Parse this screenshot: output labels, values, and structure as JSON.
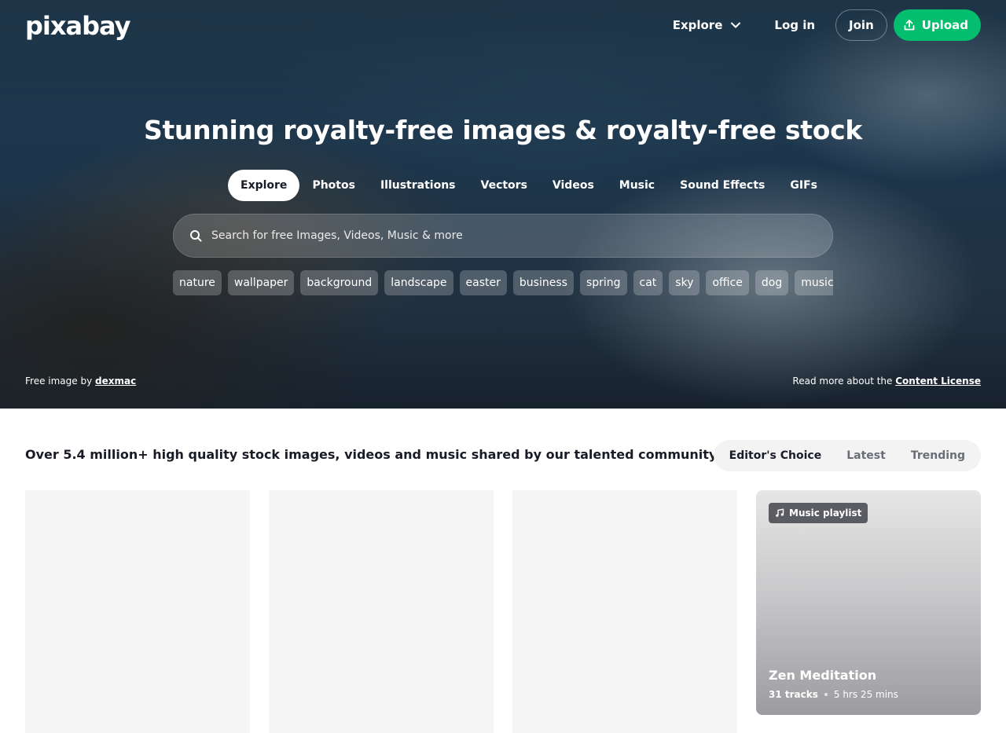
{
  "brand": {
    "logo_text": "pixabay",
    "accent_color": "#02be6e"
  },
  "topnav": {
    "explore_label": "Explore",
    "login_label": "Log in",
    "join_label": "Join",
    "upload_label": "Upload"
  },
  "hero": {
    "title": "Stunning royalty-free images & royalty-free stock",
    "tabs": [
      {
        "label": "Explore",
        "active": true
      },
      {
        "label": "Photos"
      },
      {
        "label": "Illustrations"
      },
      {
        "label": "Vectors"
      },
      {
        "label": "Videos"
      },
      {
        "label": "Music"
      },
      {
        "label": "Sound Effects"
      },
      {
        "label": "GIFs"
      }
    ],
    "search_placeholder": "Search for free Images, Videos, Music & more",
    "chips": [
      "nature",
      "wallpaper",
      "background",
      "landscape",
      "easter",
      "business",
      "spring",
      "cat",
      "sky",
      "office",
      "dog",
      "music"
    ],
    "credit_prefix": "Free image by",
    "credit_author": "dexmac",
    "license_prefix": "Read more about the",
    "license_link": "Content License"
  },
  "main": {
    "tagline": "Over 5.4 million+ high quality stock images, videos and music shared by our talented community.",
    "sort_tabs": [
      {
        "label": "Editor's Choice",
        "active": true
      },
      {
        "label": "Latest"
      },
      {
        "label": "Trending"
      }
    ],
    "playlist": {
      "badge": "Music playlist",
      "title": "Zen Meditation",
      "tracks": "31 tracks",
      "duration": "5 hrs 25 mins"
    }
  }
}
